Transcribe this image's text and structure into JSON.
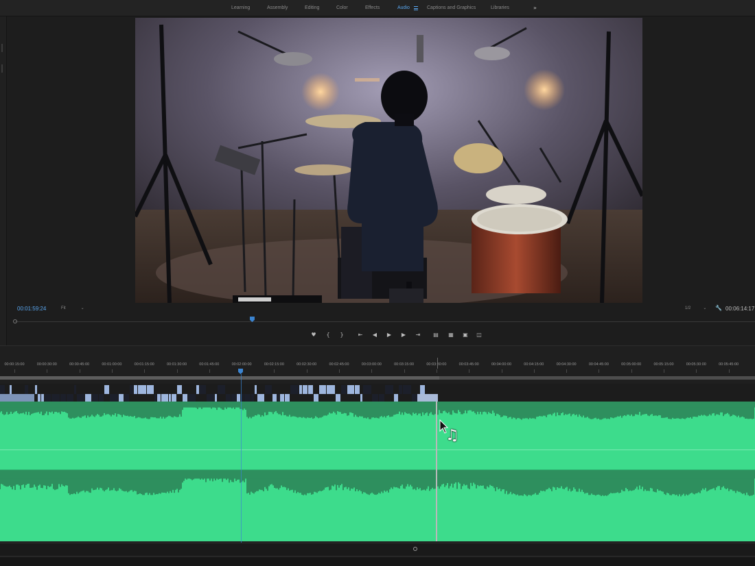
{
  "workspaces": [
    {
      "label": "Learning",
      "active": false
    },
    {
      "label": "Assembly",
      "active": false
    },
    {
      "label": "Editing",
      "active": false
    },
    {
      "label": "Color",
      "active": false
    },
    {
      "label": "Effects",
      "active": false
    },
    {
      "label": "Audio",
      "active": true
    },
    {
      "label": "Captions and Graphics",
      "active": false
    },
    {
      "label": "Libraries",
      "active": false
    }
  ],
  "workspace_more": "»",
  "monitor": {
    "current_timecode": "00:01:59:24",
    "zoom_label": "Fit",
    "resolution_label": "1/2",
    "duration_timecode": "00:06:14:17",
    "playhead_fraction": 0.32
  },
  "transport_icons": [
    "add-marker-icon",
    "mark-in-icon",
    "mark-out-icon",
    "go-to-in-icon",
    "step-back-icon",
    "play-icon",
    "step-forward-icon",
    "go-to-out-icon",
    "lift-icon",
    "extract-icon",
    "export-frame-icon",
    "comparison-view-icon"
  ],
  "timeline": {
    "ruler_labels": [
      "00:00:15:00",
      "00:00:30:00",
      "00:00:45:00",
      "00:01:00:00",
      "00:01:15:00",
      "00:01:30:00",
      "00:01:45:00",
      "00:02:00:00",
      "00:02:15:00",
      "00:02:30:00",
      "00:02:45:00",
      "00:03:00:00",
      "00:03:15:00",
      "00:03:30:00",
      "00:03:45:00",
      "00:04:00:00",
      "00:04:15:00",
      "00:04:30:00",
      "00:04:45:00",
      "00:05:00:00",
      "00:05:15:00",
      "00:05:30:00",
      "00:05:45:00"
    ],
    "cursor_icon": "music-note-icon",
    "cursor_glyph": "♫"
  },
  "colors": {
    "accent": "#3b84d1",
    "audio_waveform": "#3ddc8c",
    "audio_waveform_dark": "#2e8f5e",
    "active_workspace": "#5aa7f0"
  }
}
